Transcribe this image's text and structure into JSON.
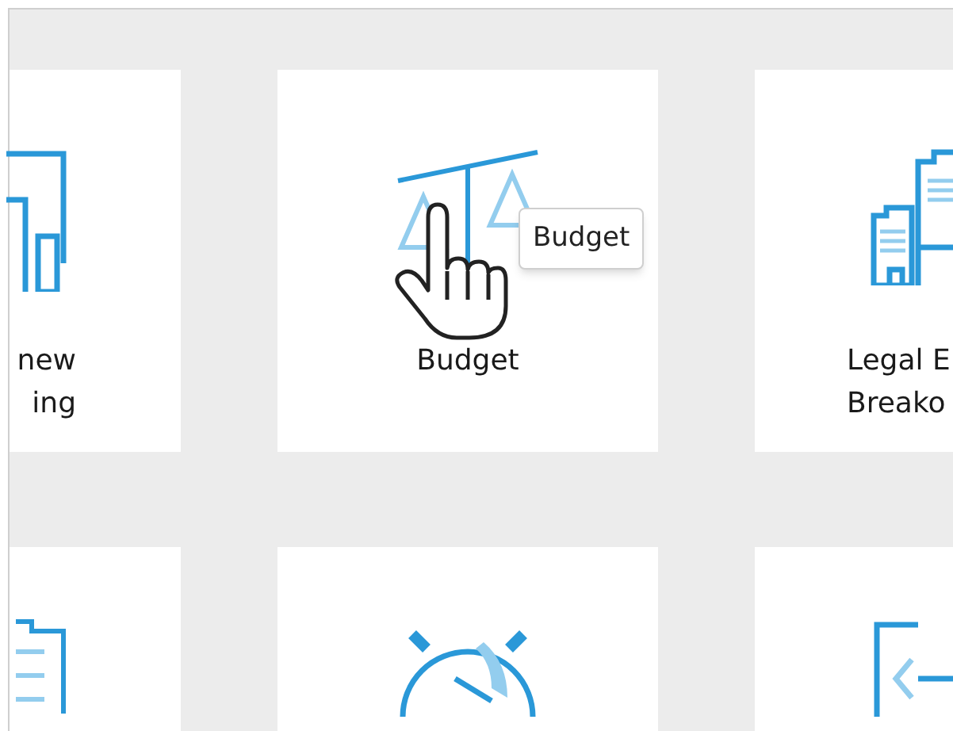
{
  "tiles": [
    {
      "kind": "chart",
      "lines": [
        "new",
        "ing"
      ]
    },
    {
      "kind": "scale",
      "lines": [
        "Budget"
      ]
    },
    {
      "kind": "buildings",
      "lines": [
        "Legal E",
        "Breako"
      ]
    },
    {
      "kind": "document"
    },
    {
      "kind": "stopwatch"
    },
    {
      "kind": "login"
    }
  ],
  "tooltip": {
    "text": "Budget"
  }
}
